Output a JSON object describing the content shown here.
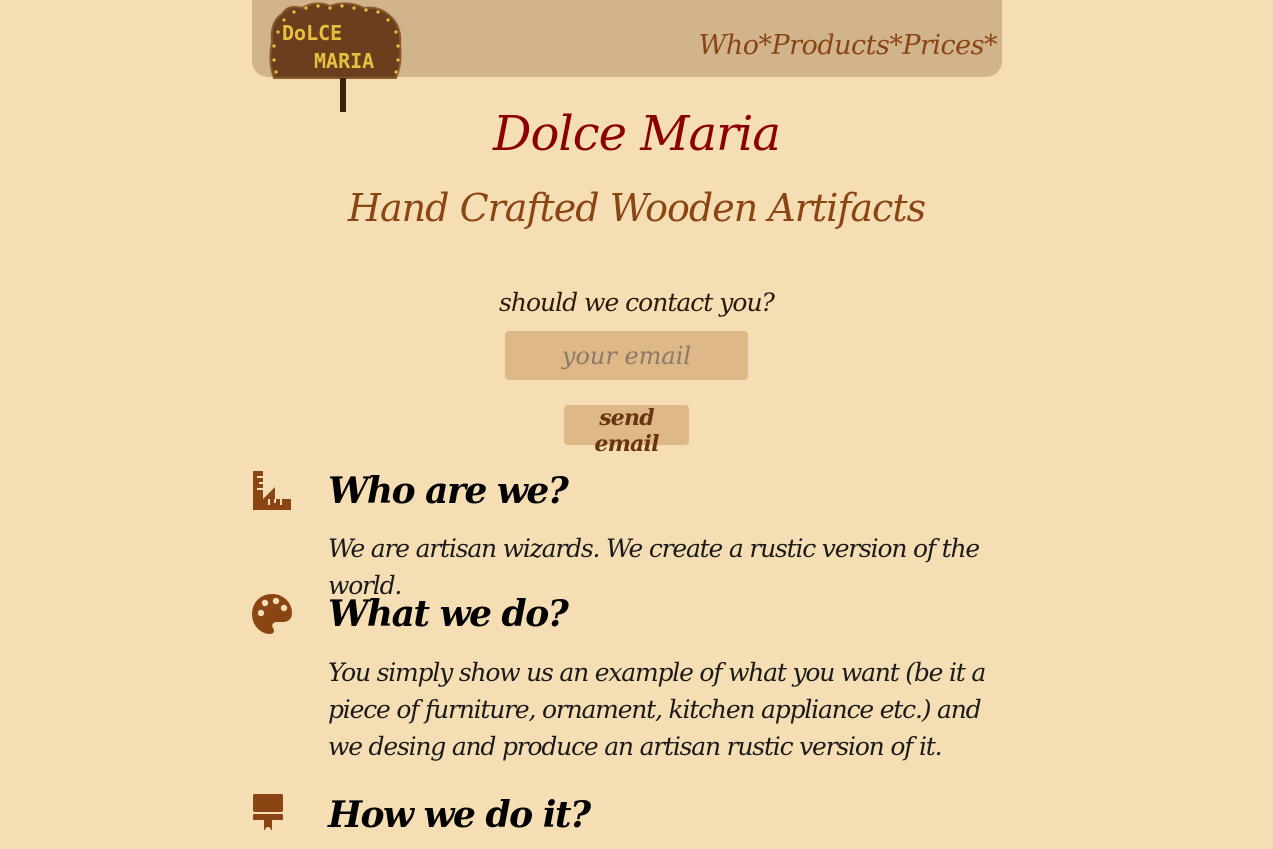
{
  "header": {
    "logo_text_line1": "DoLCE",
    "logo_text_line2": "MARIA",
    "nav": [
      {
        "label": "Who"
      },
      {
        "label": "Products"
      },
      {
        "label": "Prices"
      }
    ],
    "nav_separator": "*",
    "nav_trailing": "*"
  },
  "hero": {
    "title": "Dolce Maria",
    "subtitle": "Hand Crafted Wooden Artifacts"
  },
  "contact": {
    "label": "should we contact you?",
    "email_placeholder": "your email",
    "email_value": "",
    "send_label": "send email"
  },
  "sections": [
    {
      "icon": "ruler-combined-icon",
      "heading": "Who are we?",
      "text": "We are artisan wizards. We create a rustic version of the world."
    },
    {
      "icon": "palette-icon",
      "heading": "What we do?",
      "text": "You simply show us an example of what you want (be it a piece of furniture, ornament, kitchen appliance etc.) and we desing and produce an artisan rustic version of it."
    },
    {
      "icon": "paint-brush-icon",
      "heading": "How we do it?",
      "text": ""
    }
  ],
  "colors": {
    "background": "#f5deb3",
    "header": "#d2b48c",
    "accent_brown": "#8b4513",
    "title_red": "#8b0000",
    "input_bg": "#deb887"
  }
}
